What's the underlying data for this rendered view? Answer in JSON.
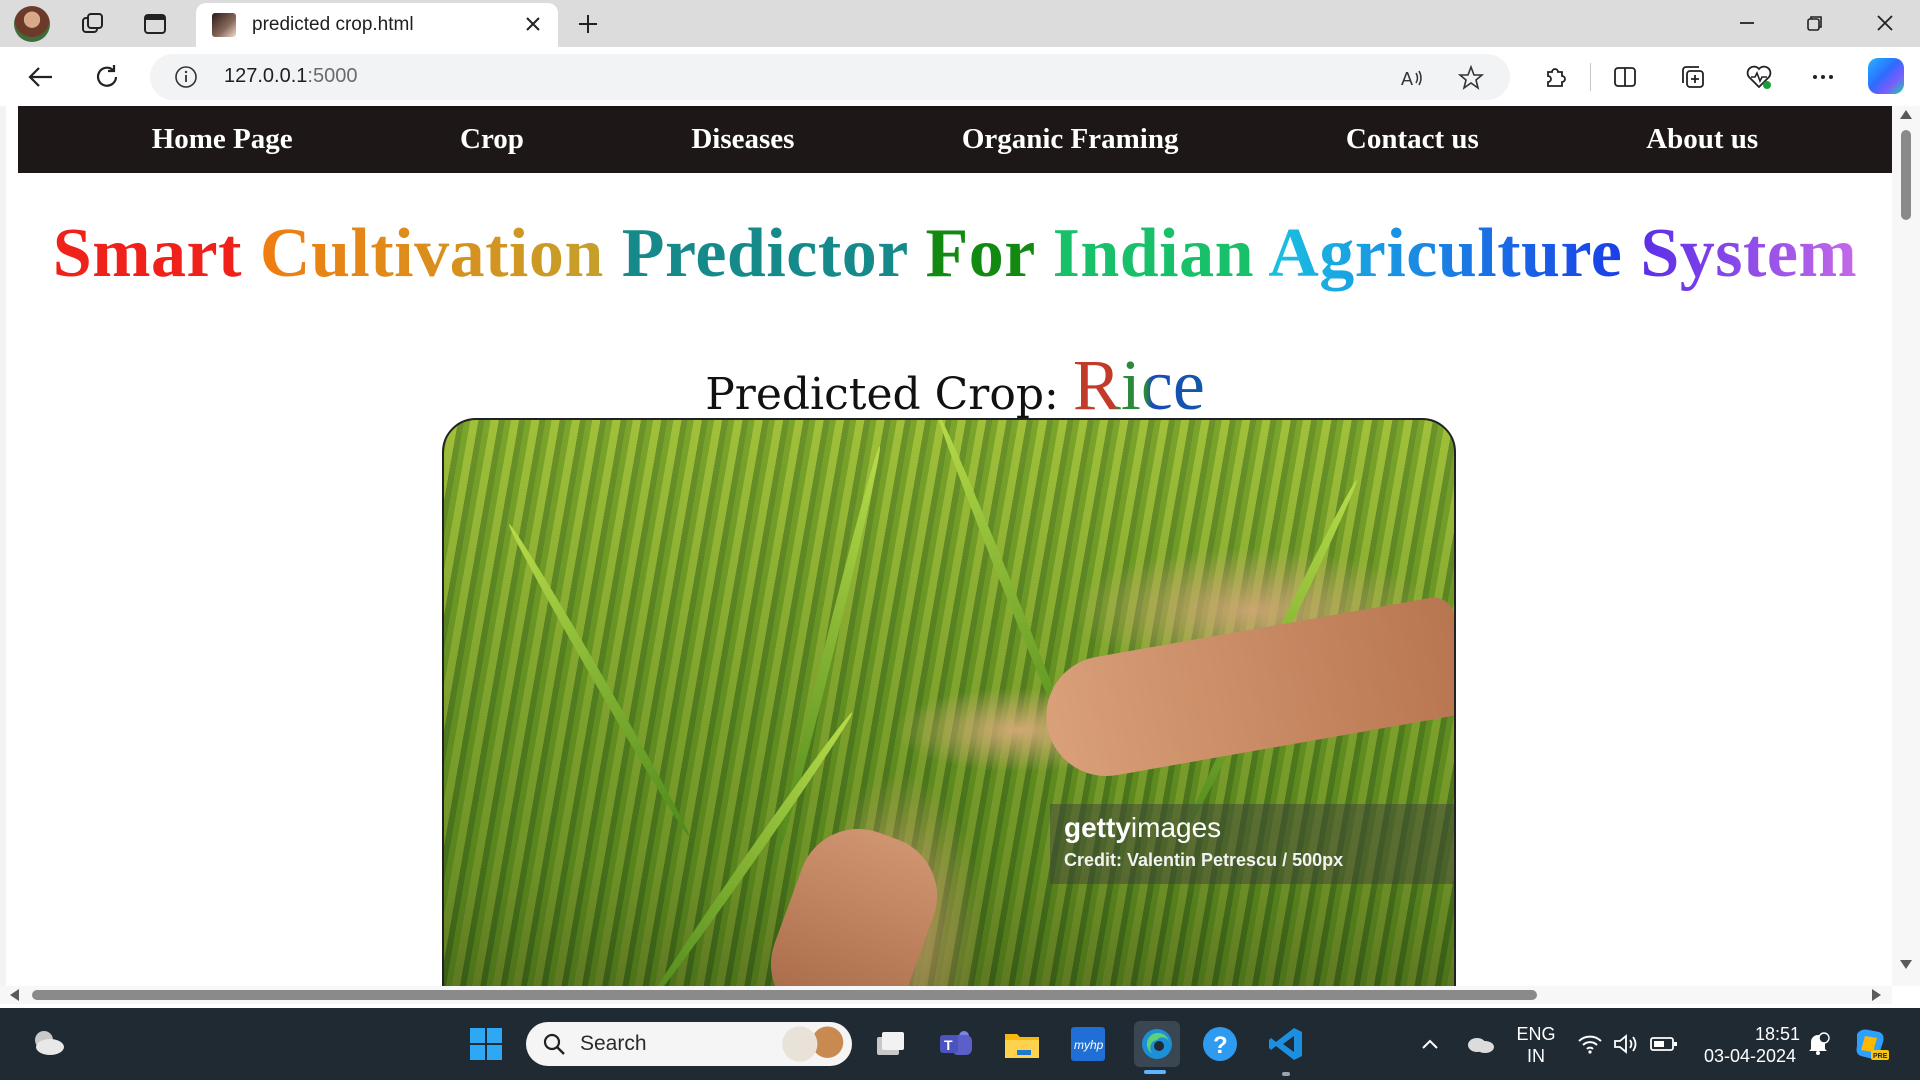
{
  "browser": {
    "tab_title": "predicted crop.html",
    "url_host": "127.0.0.1",
    "url_port": ":5000"
  },
  "nav": {
    "items": [
      "Home Page",
      "Crop",
      "Diseases",
      "Organic Framing",
      "Contact us",
      "About us"
    ]
  },
  "headline": {
    "words": [
      {
        "text": "Smart",
        "color": "#f0201a"
      },
      {
        "text": "Cultivation",
        "color": "#e8861a"
      },
      {
        "text": "Predictor",
        "color": "#168a8a"
      },
      {
        "text": "For",
        "color": "#128a12"
      },
      {
        "text": "Indian",
        "color": "#18c06a"
      },
      {
        "text": "Agriculture",
        "color": "#1aa7ec"
      },
      {
        "text": "System",
        "color": "#6a34e8"
      }
    ]
  },
  "result": {
    "label": "Predicted Crop:",
    "crop": "Rice"
  },
  "photo": {
    "watermark_brand_bold": "getty",
    "watermark_brand_light": "images",
    "credit": "Credit: Valentin Petrescu / 500px"
  },
  "taskbar": {
    "search_placeholder": "Search",
    "language": "ENG",
    "region": "IN",
    "time": "18:51",
    "date": "03-04-2024"
  },
  "icons": [
    "profile-avatar",
    "workspaces-icon",
    "tab-actions-icon",
    "close-icon",
    "new-tab-icon",
    "minimize-icon",
    "restore-icon",
    "window-close-icon",
    "back-icon",
    "refresh-icon",
    "info-icon",
    "read-aloud-icon",
    "favorite-star-icon",
    "extensions-icon",
    "split-screen-icon",
    "collections-icon",
    "browser-essentials-icon",
    "more-icon",
    "copilot-icon",
    "weather-icon",
    "start-icon",
    "search-icon",
    "task-view-icon",
    "teams-icon",
    "file-explorer-icon",
    "myhp-icon",
    "edge-icon",
    "help-icon",
    "vscode-icon",
    "chevron-up-icon",
    "onedrive-icon",
    "wifi-icon",
    "volume-icon",
    "battery-icon",
    "notification-icon"
  ]
}
